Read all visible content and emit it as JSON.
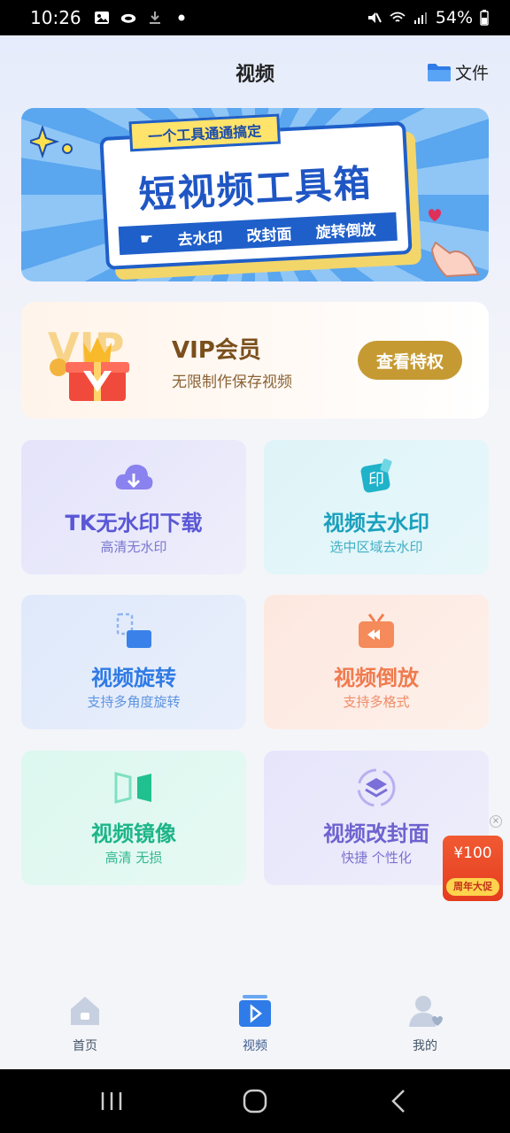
{
  "status_bar": {
    "time": "10:26",
    "battery": "54%",
    "icons": [
      "image-icon",
      "cloud-icon",
      "download-icon",
      "dot-icon",
      "mute-icon",
      "wifi-icon",
      "signal-icon",
      "battery-icon"
    ]
  },
  "header": {
    "title": "视频",
    "file_label": "文件"
  },
  "banner": {
    "tag": "一个工具通通搞定",
    "headline": "短视频工具箱",
    "features": [
      "去水印",
      "改封面",
      "旋转倒放"
    ]
  },
  "vip": {
    "art_text": "VIP",
    "title": "VIP会员",
    "subtitle": "无限制作保存视频",
    "button": "查看特权"
  },
  "tools": [
    {
      "title": "TK无水印下载",
      "subtitle": "高清无水印",
      "icon": "cloud-download-icon",
      "color": "#6b63e0"
    },
    {
      "title": "视频去水印",
      "subtitle": "选中区域去水印",
      "icon": "stamp-icon",
      "color": "#19a7c4"
    },
    {
      "title": "视频旋转",
      "subtitle": "支持多角度旋转",
      "icon": "rotate-icon",
      "color": "#3a82ea"
    },
    {
      "title": "视频倒放",
      "subtitle": "支持多格式",
      "icon": "rewind-tv-icon",
      "color": "#f27d4f"
    },
    {
      "title": "视频镜像",
      "subtitle": "高清 无损",
      "icon": "mirror-icon",
      "color": "#21c08f"
    },
    {
      "title": "视频改封面",
      "subtitle": "快捷 个性化",
      "icon": "layers-icon",
      "color": "#7a6fd8"
    }
  ],
  "promo": {
    "amount": "¥100",
    "tag": "周年大促",
    "close": "×"
  },
  "tabbar": {
    "items": [
      {
        "label": "首页",
        "icon": "home-icon"
      },
      {
        "label": "视频",
        "icon": "video-icon"
      },
      {
        "label": "我的",
        "icon": "profile-icon"
      }
    ]
  },
  "navbar": {
    "icons": [
      "recents-icon",
      "home-circle-icon",
      "back-icon"
    ]
  }
}
